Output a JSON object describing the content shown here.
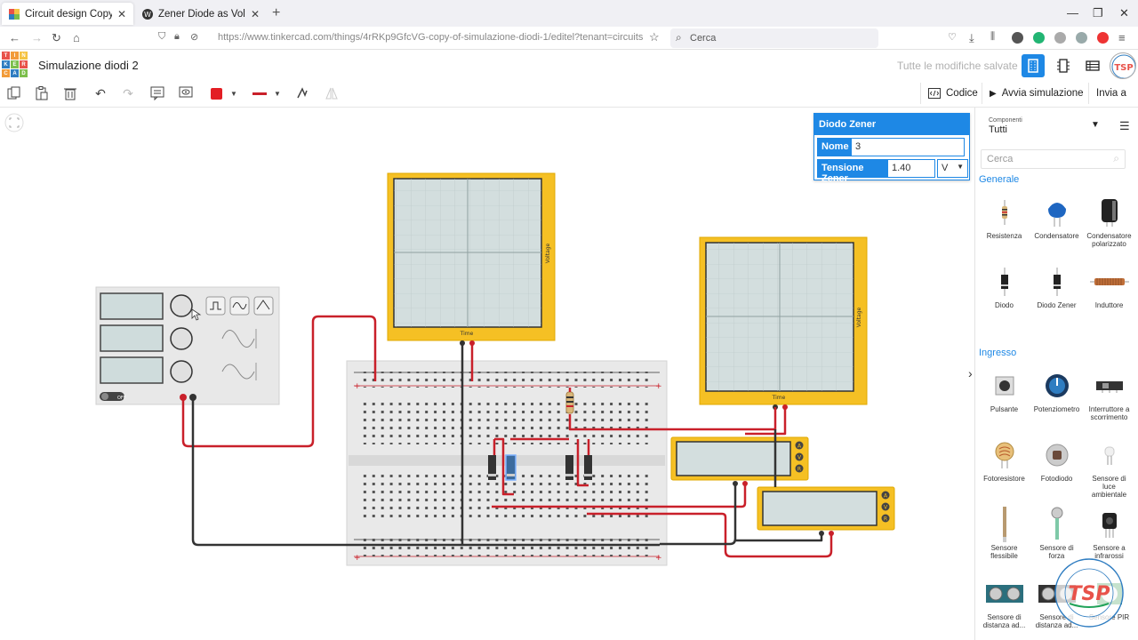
{
  "browser": {
    "tabs": [
      {
        "title": "Circuit design Copy of Simulazi",
        "active": true
      },
      {
        "title": "Zener Diode as Voltage Regulat",
        "active": false
      }
    ],
    "url": "https://www.tinkercad.com/things/4rRKp9GfcVG-copy-of-simulazione-diodi-1/editel?tenant=circuits",
    "search_placeholder": "Cerca"
  },
  "app": {
    "logo_letters": [
      "T",
      "I",
      "N",
      "K",
      "E",
      "R",
      "C",
      "A",
      "D"
    ],
    "logo_colors": [
      "#e8524a",
      "#f29b39",
      "#f5c342",
      "#2f7dc1",
      "#7cbf4c",
      "#e8524a",
      "#f29b39",
      "#2f7dc1",
      "#7cbf4c"
    ],
    "title": "Simulazione diodi 2",
    "saved_status": "Tutte le modifiche salvate"
  },
  "toolbar": {
    "code_label": "Codice",
    "simulate_label": "Avvia simulazione",
    "send_label": "Invia a",
    "fill_color": "#e31e24"
  },
  "properties": {
    "header": "Diodo Zener",
    "name_label": "Nome",
    "name_value": "3",
    "voltage_label": "Tensione Zener",
    "voltage_value": "1.40",
    "unit": "V"
  },
  "components_panel": {
    "title": "Componenti",
    "filter": "Tutti",
    "search_placeholder": "Cerca",
    "sections": [
      {
        "name": "Generale",
        "items": [
          "Resistenza",
          "Condensatore",
          "Condensatore polarizzato",
          "Diodo",
          "Diodo Zener",
          "Induttore"
        ]
      },
      {
        "name": "Ingresso",
        "items": [
          "Pulsante",
          "Potenziometro",
          "Interruttore a scorrimento",
          "Fotoresistore",
          "Fotodiodo",
          "Sensore di luce ambientale",
          "Sensore flessibile",
          "Sensore di forza",
          "Sensore a infrarossi",
          "Sensore di distanza ad...",
          "Sensore di distanza ad...",
          "Sensore PIR"
        ]
      }
    ]
  },
  "circuit": {
    "scope_label_time": "Time",
    "scope_label_voltage": "Voltage",
    "generator_switch": "OFF",
    "multimeter_modes": [
      "A",
      "V",
      "R"
    ],
    "breadboard_rows_top": [
      "j",
      "i",
      "h",
      "g",
      "f"
    ],
    "breadboard_rows_bottom": [
      "e",
      "d",
      "c",
      "b",
      "a"
    ]
  },
  "colors": {
    "accent": "#1e88e5",
    "scope_frame": "#f5c024",
    "wire_red": "#c9202a",
    "wire_black": "#333333"
  }
}
